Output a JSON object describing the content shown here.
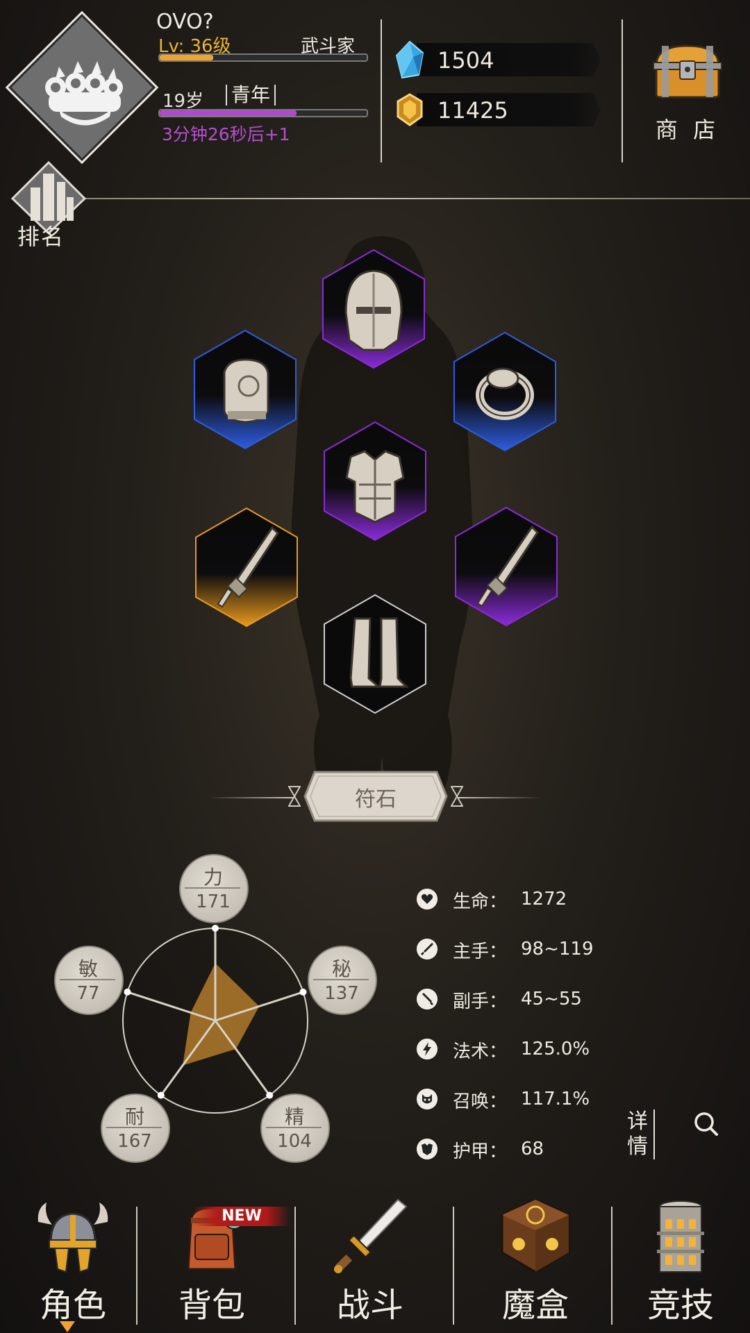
{
  "player": {
    "name": "OVO?",
    "level": "Lv: 36级",
    "class": "武斗家",
    "level_progress": 0.26,
    "age": "19岁",
    "stage": "青年",
    "age_progress": 0.66,
    "timer": "3分钟26秒后+1",
    "avatar_icon": "brass-knuckles-icon"
  },
  "currency": {
    "gems": "1504",
    "gold": "11425"
  },
  "shop": {
    "label": "商 店",
    "icon": "treasure-chest-icon"
  },
  "ranking": {
    "label": "排名",
    "icon": "ranking-bars-icon"
  },
  "equipment": {
    "slots": [
      {
        "slot": "helmet",
        "rarity": "purple"
      },
      {
        "slot": "gloves",
        "rarity": "blue"
      },
      {
        "slot": "ring",
        "rarity": "blue"
      },
      {
        "slot": "armor",
        "rarity": "purple"
      },
      {
        "slot": "main-weapon",
        "rarity": "orange"
      },
      {
        "slot": "off-weapon",
        "rarity": "purple"
      },
      {
        "slot": "boots",
        "rarity": "none"
      }
    ],
    "rarity_colors": {
      "purple": "#8a2bd9",
      "blue": "#2d5de0",
      "orange": "#e89a1d",
      "none": "#cfcfcf"
    }
  },
  "rune_button": {
    "label": "符石"
  },
  "stats": {
    "strength": {
      "name": "力",
      "value": "171"
    },
    "arcane": {
      "name": "秘",
      "value": "137"
    },
    "spirit": {
      "name": "精",
      "value": "104"
    },
    "endurance": {
      "name": "耐",
      "value": "167"
    },
    "agility": {
      "name": "敏",
      "value": "77"
    },
    "radar_levels": [
      0.62,
      0.5,
      0.38,
      0.6,
      0.28
    ]
  },
  "attributes": [
    {
      "label": "生命：",
      "value": "1272",
      "icon": "heart-icon"
    },
    {
      "label": "主手：",
      "value": "98~119",
      "icon": "sword-icon"
    },
    {
      "label": "副手：",
      "value": "45~55",
      "icon": "offhand-icon"
    },
    {
      "label": "法术：",
      "value": "125.0%",
      "icon": "lightning-icon"
    },
    {
      "label": "召唤：",
      "value": "117.1%",
      "icon": "summon-icon"
    },
    {
      "label": "护甲：",
      "value": "68",
      "icon": "armor-icon"
    }
  ],
  "details": {
    "label": "详情",
    "icon": "search-icon"
  },
  "nav": [
    {
      "label": "角色",
      "active": true
    },
    {
      "label": "背包",
      "badge": "NEW"
    },
    {
      "label": "战斗"
    },
    {
      "label": "魔盒"
    },
    {
      "label": "竞技"
    }
  ],
  "colors": {
    "accent": "#e8b53a",
    "age_bar": "#b049cf",
    "level_bar": "#f0a52a"
  }
}
